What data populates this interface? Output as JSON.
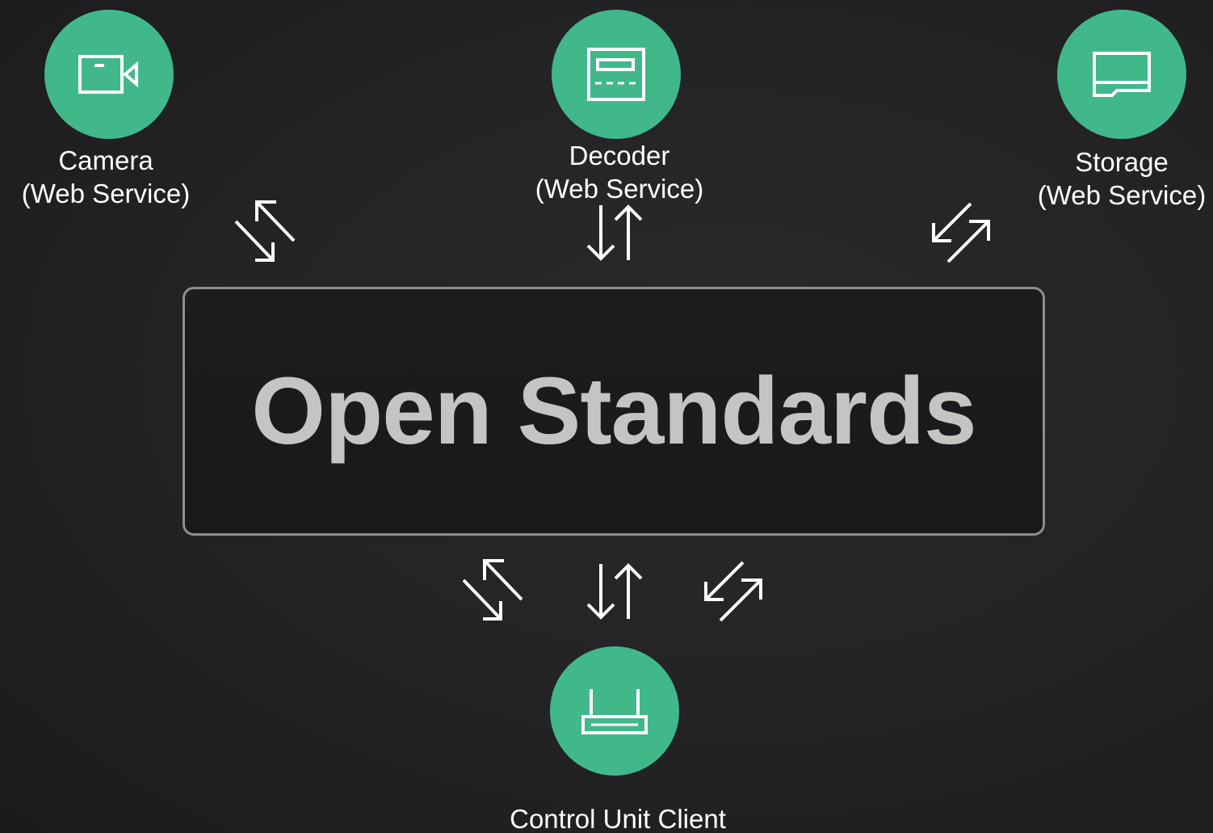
{
  "nodes": {
    "camera": {
      "line1": "Camera",
      "line2": "(Web Service)",
      "icon": "video-camera-icon"
    },
    "decoder": {
      "line1": "Decoder",
      "line2": "(Web Service)",
      "icon": "decoder-icon"
    },
    "storage": {
      "line1": "Storage",
      "line2": "(Web Service)",
      "icon": "storage-drive-icon"
    },
    "control": {
      "line1": "Control Unit Client",
      "icon": "router-icon"
    }
  },
  "center": {
    "title": "Open Standards"
  },
  "colors": {
    "node_fill": "#40b88a",
    "box_border": "#8e8e8e",
    "title_text": "#c4c4c2",
    "arrow": "#ffffff"
  }
}
